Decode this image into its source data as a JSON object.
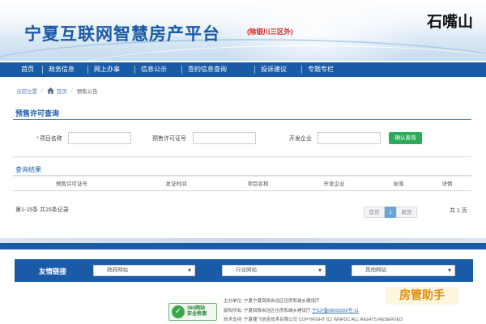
{
  "header": {
    "site_title": "宁夏互联网智慧房产平台",
    "site_subtitle": "(除银川三区外)",
    "city": "石嘴山"
  },
  "nav": {
    "items": [
      "首页",
      "政务信息",
      "网上办事",
      "信息公示",
      "签约信息查询",
      "投诉建议",
      "专题专栏"
    ]
  },
  "breadcrumb": {
    "prefix": "当前位置",
    "home": "首页",
    "current": "预售公告"
  },
  "query": {
    "title": "预售许可查询",
    "required_mark": "*",
    "project_name_label": "项目名称",
    "project_name_value": "",
    "permit_no_label": "预售许可证号",
    "permit_no_value": "",
    "developer_label": "开发企业",
    "developer_value": "",
    "search_button": "确认查询"
  },
  "results": {
    "title": "查询结果",
    "columns": [
      "预售许可证号",
      "发证时间",
      "项目名称",
      "开发企业",
      "坐落",
      "详情"
    ],
    "records_text": "第1-15条  共15条记录",
    "pager": {
      "prev": "首页",
      "current": "1",
      "next": "尾页",
      "total_text": "共 1 页"
    }
  },
  "links": {
    "label": "友情链接",
    "selects": [
      "政府网站",
      "行业网站",
      "其他网站"
    ]
  },
  "footer": {
    "badge_line1": "360网站",
    "badge_line2": "安全检测",
    "host": "主办单位:  宁夏宁夏回族自治区住房和城乡建设厅",
    "copyright_prefix": "版权所有:  宁夏回族自治区住房和城乡建设厅 ",
    "icp": "宁ICP备08000286号-11",
    "tech": "技术支持:  宁夏捷飞信息技术有限公司  COPYRIGHT (C) WNFDC ALL RIGHTS RESERVED"
  },
  "assistant_badge": "房管助手",
  "colors": {
    "brand_blue": "#1a5ba7",
    "title_blue": "#1a5aa6",
    "subtitle_red": "#e0211c",
    "search_green": "#2eaa5b",
    "pager_active": "#6aa7d8",
    "assistant_orange": "#e48a00"
  },
  "icons": {
    "home": "home-icon",
    "chevron": "chevron-down-icon",
    "badge": "360-shield-icon"
  }
}
